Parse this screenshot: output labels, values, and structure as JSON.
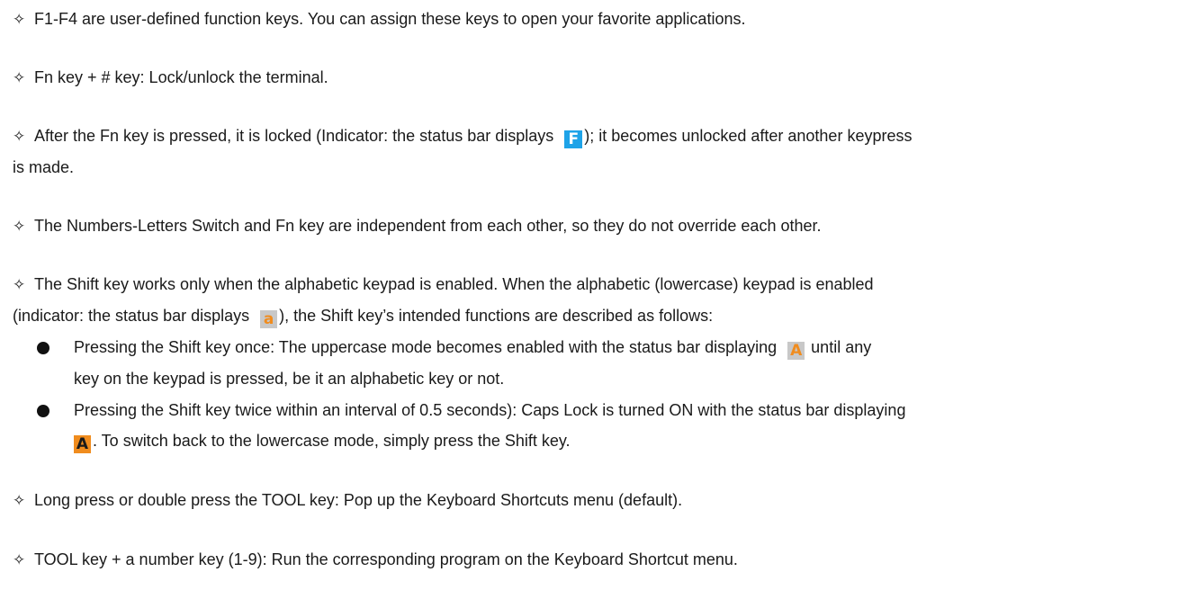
{
  "icons": {
    "fn_indicator": {
      "name": "fn-indicator-icon",
      "glyph": "F",
      "color": "#1ea3e8"
    },
    "lowercase_indicator": {
      "name": "lowercase-indicator-icon",
      "glyph": "a",
      "color": "#f08c1e"
    },
    "uppercase_indicator": {
      "name": "uppercase-indicator-icon",
      "glyph": "A",
      "color": "#f08c1e"
    },
    "capslock_indicator": {
      "name": "capslock-indicator-icon",
      "glyph": "A",
      "color": "#f08c1e"
    },
    "diamond": "✧"
  },
  "items": {
    "f1_f4": "F1-F4 are user-defined function keys. You can assign these keys to open your favorite applications.",
    "fn_hash": "Fn key + # key: Lock/unlock the terminal.",
    "fn_lock_pre": "After the Fn key is pressed, it is locked (Indicator: the status bar displays",
    "fn_lock_post": "); it becomes unlocked after another keypress",
    "fn_lock_cont": "is made.",
    "independent": "The Numbers-Letters Switch and Fn key are independent from each other, so they do not override each other.",
    "shift_intro": "The Shift key works only when the alphabetic keypad is enabled. When the alphabetic (lowercase) keypad is enabled",
    "shift_intro2_pre": "(indicator: the status bar displays",
    "shift_intro2_post": "), the Shift key’s intended functions are described as follows:",
    "shift_once_pre": "Pressing the Shift key once: The uppercase mode becomes enabled with the status bar displaying",
    "shift_once_post": "until any",
    "shift_once_cont": "key on the keypad is pressed, be it an alphabetic key or not.",
    "shift_twice": "Pressing the Shift key twice within an interval of 0.5 seconds): Caps Lock is turned ON with the status bar displaying",
    "shift_twice_cont": ". To switch back to the lowercase mode, simply press the Shift key.",
    "tool_long": "Long press or double press the TOOL key: Pop up the Keyboard Shortcuts menu (default).",
    "tool_number": "TOOL key + a number key (1-9): Run the corresponding program on the Keyboard Shortcut menu."
  }
}
